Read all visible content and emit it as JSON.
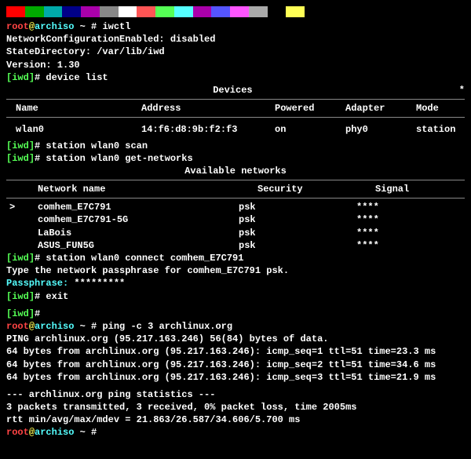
{
  "prompt": {
    "user": "root",
    "at": "@",
    "host": "archiso",
    "path": " ~ ",
    "sym": "# "
  },
  "iwd_prompt": {
    "open": "[",
    "label": "iwd",
    "close": "]",
    "sym": "# "
  },
  "cmd1": "iwctl",
  "conf1": "NetworkConfigurationEnabled: disabled",
  "conf2": "StateDirectory: /var/lib/iwd",
  "conf3": "Version: 1.30",
  "cmd2": "device list",
  "devices_title": "Devices",
  "asterisk": "*",
  "dev_headers": {
    "name": "Name",
    "address": "Address",
    "powered": "Powered",
    "adapter": "Adapter",
    "mode": "Mode"
  },
  "dev_row": {
    "name": "wlan0",
    "address": "14:f6:d8:9b:f2:f3",
    "powered": "on",
    "adapter": "phy0",
    "mode": "station"
  },
  "cmd3": "station wlan0 scan",
  "cmd4": "station wlan0 get-networks",
  "net_title": "Available networks",
  "net_headers": {
    "name": "Network name",
    "security": "Security",
    "signal": "Signal"
  },
  "networks": [
    {
      "sel": ">",
      "name": "comhem_E7C791",
      "security": "psk",
      "signal": "****"
    },
    {
      "sel": " ",
      "name": "comhem_E7C791-5G",
      "security": "psk",
      "signal": "****"
    },
    {
      "sel": " ",
      "name": "LaBois",
      "security": "psk",
      "signal": "****"
    },
    {
      "sel": " ",
      "name": "ASUS_FUN5G",
      "security": "psk",
      "signal": "****"
    }
  ],
  "cmd5": "station wlan0 connect comhem_E7C791",
  "pass_prompt": "Type the network passphrase for comhem_E7C791 psk.",
  "pass_label": "Passphrase: ",
  "pass_value": "*********",
  "cmd6": "exit",
  "cmd7": "ping -c 3 archlinux.org",
  "ping_header": "PING archlinux.org (95.217.163.246) 56(84) bytes of data.",
  "ping1": "64 bytes from archlinux.org (95.217.163.246): icmp_seq=1 ttl=51 time=23.3 ms",
  "ping2": "64 bytes from archlinux.org (95.217.163.246): icmp_seq=2 ttl=51 time=34.6 ms",
  "ping3": "64 bytes from archlinux.org (95.217.163.246): icmp_seq=3 ttl=51 time=21.9 ms",
  "stats_hdr": "--- archlinux.org ping statistics ---",
  "stats1": "3 packets transmitted, 3 received, 0% packet loss, time 2005ms",
  "stats2": "rtt min/avg/max/mdev = 21.863/26.587/34.606/5.700 ms",
  "colorbar": [
    "#ff0000",
    "#00aa00",
    "#00aaaa",
    "#000088",
    "#aa00aa",
    "#888888",
    "#ffffff",
    "#ff5555",
    "#55ff55",
    "#55ffff",
    "#aa00aa",
    "#5555ff",
    "#ff55ff",
    "#aaaaaa",
    "#000000",
    "#ffff55"
  ]
}
